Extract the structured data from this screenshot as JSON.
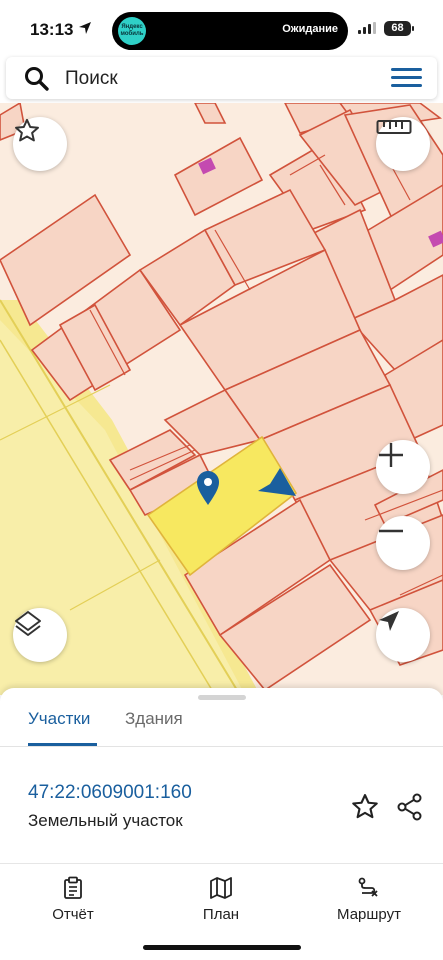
{
  "status_bar": {
    "time": "13:13",
    "island_badge": "Яндекс мобиль",
    "island_status": "Ожидание",
    "battery": "68"
  },
  "search": {
    "placeholder": "Поиск",
    "search_icon": "search-icon",
    "menu_icon": "hamburger-menu-icon"
  },
  "map": {
    "controls": [
      "favorite-star-icon",
      "ruler-icon",
      "zoom-in-icon",
      "zoom-out-icon",
      "layers-icon",
      "my-location-icon"
    ],
    "colors": {
      "parcel_fill": "#f7d5c5",
      "parcel_border": "#d1533c",
      "selected_parcel": "#f7e860",
      "road_fill": "#f7ecb2",
      "accent": "#1a5f9e"
    }
  },
  "sheet": {
    "tabs": [
      {
        "label": "Участки",
        "active": true
      },
      {
        "label": "Здания",
        "active": false
      }
    ],
    "parcel": {
      "cadastral_number": "47:22:0609001:160",
      "type": "Земельный участок"
    }
  },
  "bottom_nav": [
    {
      "label": "Отчёт",
      "icon": "report-clipboard-icon"
    },
    {
      "label": "План",
      "icon": "map-plan-icon"
    },
    {
      "label": "Маршрут",
      "icon": "route-icon"
    }
  ]
}
